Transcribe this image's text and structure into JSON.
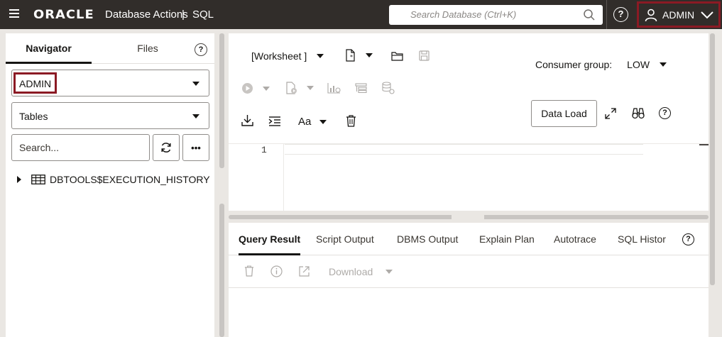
{
  "header": {
    "brand": "ORACLE",
    "app_title": "Database Actions",
    "separator": "|",
    "page": "SQL",
    "search_placeholder": "Search Database (Ctrl+K)",
    "help": "?",
    "user": "ADMIN"
  },
  "navigator": {
    "tabs": [
      "Navigator",
      "Files"
    ],
    "help": "?",
    "schema": "ADMIN",
    "object_type": "Tables",
    "search_placeholder": "Search...",
    "more": "•••",
    "tree_items": [
      "DBTOOLS$EXECUTION_HISTORY"
    ]
  },
  "worksheet": {
    "name": "[Worksheet ]",
    "consumer_group_label": "Consumer group:",
    "consumer_group_value": "LOW",
    "data_load": "Data Load",
    "text_size": "Aa",
    "line_numbers": [
      "1"
    ]
  },
  "results": {
    "tabs": [
      "Query Result",
      "Script Output",
      "DBMS Output",
      "Explain Plan",
      "Autotrace",
      "SQL Histor"
    ],
    "active_tab": "Query Result",
    "help": "?",
    "download": "Download"
  }
}
